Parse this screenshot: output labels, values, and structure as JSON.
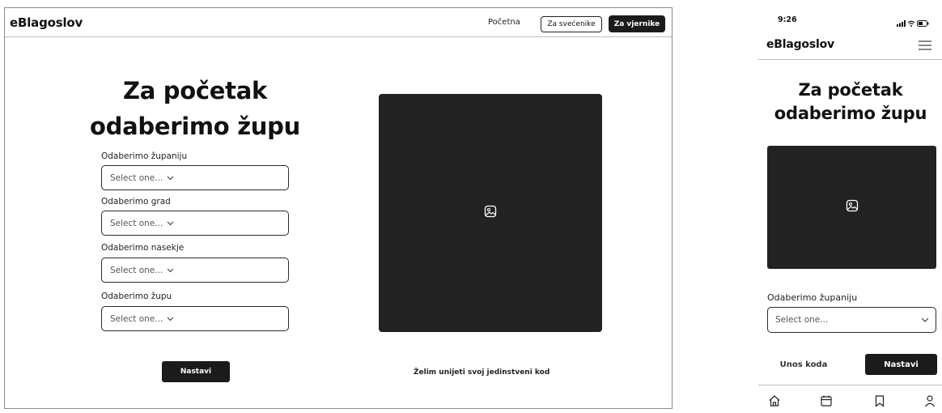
{
  "desktop": {
    "logo": "eBlagoslov",
    "nav": {
      "home": "Početna",
      "for_priests": "Za svećenike",
      "for_believers": "Za vjernike"
    },
    "title_line1": "Za početak",
    "title_line2": "odaberimo župu",
    "fields": [
      {
        "label": "Odaberimo županiju",
        "placeholder": "Select one..."
      },
      {
        "label": "Odaberimo grad",
        "placeholder": "Select one..."
      },
      {
        "label": "Odaberimo nasekje",
        "placeholder": "Select one..."
      },
      {
        "label": "Odaberimo župu",
        "placeholder": "Select one..."
      }
    ],
    "continue_label": "Nastavi",
    "code_link": "Želim unijeti svoj jedinstveni kod"
  },
  "mobile": {
    "time": "9:26",
    "logo": "eBlagoslov",
    "title_line1": "Za početak",
    "title_line2": "odaberimo župu",
    "field_label": "Odaberimo županiju",
    "select_placeholder": "Select one...",
    "code_button": "Unos koda",
    "continue_label": "Nastavi",
    "tabs": [
      "home-icon",
      "calendar-icon",
      "bookmark-icon",
      "user-icon"
    ]
  },
  "colors": {
    "primary_dark": "#1b1b1b",
    "image_placeholder": "#222222",
    "border": "#2b2b2b"
  }
}
